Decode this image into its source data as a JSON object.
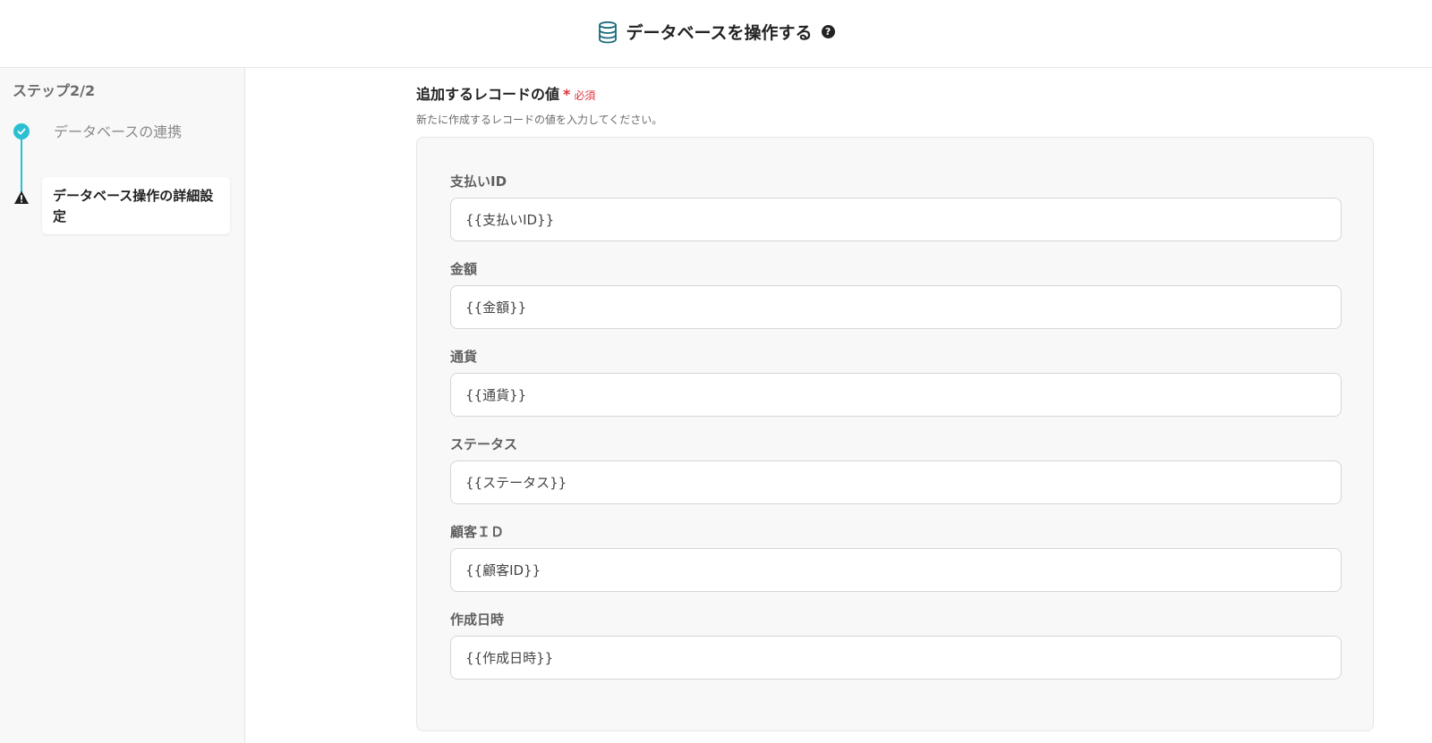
{
  "header": {
    "title": "データベースを操作する",
    "icons": {
      "title_icon": "database-icon",
      "help": "question-circle-icon"
    },
    "help_glyph": "?"
  },
  "sidebar": {
    "step_label": "ステップ2/2",
    "steps": [
      {
        "label": "データベースの連携",
        "status": "completed",
        "icon": "check-circle-icon"
      },
      {
        "label": "データベース操作の詳細設定",
        "status": "warning-current",
        "icon": "warning-icon"
      }
    ]
  },
  "main": {
    "section_title": "追加するレコードの値",
    "required_mark": "*",
    "required_text": "必須",
    "description": "新たに作成するレコードの値を入力してください。",
    "fields": [
      {
        "label": "支払いID",
        "value": "{{支払いID}}"
      },
      {
        "label": "金額",
        "value": "{{金額}}"
      },
      {
        "label": "通貨",
        "value": "{{通貨}}"
      },
      {
        "label": "ステータス",
        "value": "{{ステータス}}"
      },
      {
        "label": "顧客ＩＤ",
        "value": "{{顧客ID}}"
      },
      {
        "label": "作成日時",
        "value": "{{作成日時}}"
      }
    ]
  },
  "colors": {
    "accent": "#2bbfd3",
    "required": "#e0323b",
    "panel_bg": "#f8f8f8",
    "sidebar_bg": "#f8f8f8"
  }
}
